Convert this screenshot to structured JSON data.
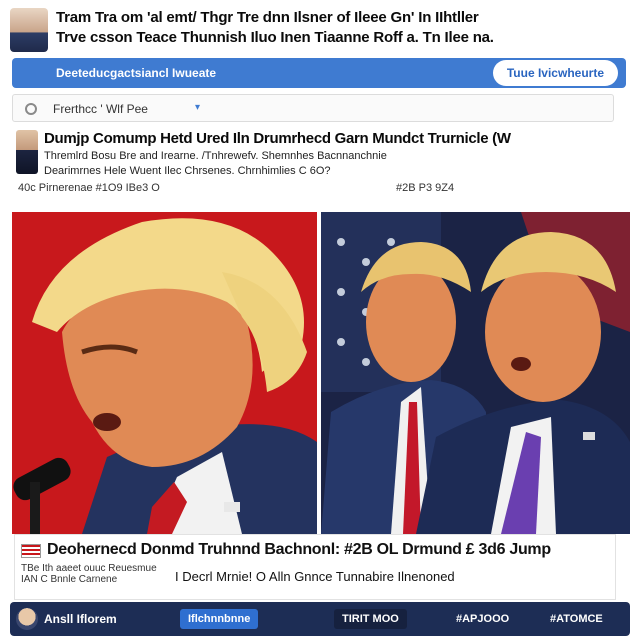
{
  "header": {
    "line1": "Tram Tra om 'al emt/ Thgr Tre dnn Ilsner of Ileee Gn' In IIhtller",
    "line2": "Trve csson Teace Thunnish Iluo Inen Tiaanne Roff a. Tn Ilee na."
  },
  "banner": {
    "title": "Deeteducgactsiancl Iwueate",
    "button_label": "Tuue Ivicwheurte"
  },
  "filter": {
    "value": "Frerthcc ' Wlf Pee"
  },
  "post": {
    "headline": "Dumjp Comump Hetd Ured Iln Drumrhecd Garn Mundct Trurnicle (W",
    "sub1": "Thremlrd Bosu Bre and Irearne. /Tnhrewefv. Shemnhes Bacnnanchnie",
    "sub2": "Dearimrnes Hele Wuent Ilec Chrsenes. Chrnhimlies C 6O?",
    "meta_left": "40c Pirnerenae #1O9 IBe3 O",
    "meta_right": "#2B P3 9Z4"
  },
  "caption": {
    "title": "Deohernecd Donmd Truhnnd Bachnonl: #2B OL Drmund £ 3d6 Jump",
    "sub1": "TBe Ith aaeet ouuc Reuesmue",
    "sub1b": "IAN C Bnnle Carnene",
    "sub2": "I Decrl Mrnie! O Alln Gnnce Tunnabire Ilnenoned"
  },
  "footer": {
    "name": "Ansll Iflorem",
    "btn1": "Iflchnnbnne",
    "btn2": "TIRIT MOO",
    "btn3": "#APJOOO",
    "btn4": "#ATOMCE"
  },
  "colors": {
    "accent": "#3f7bd1",
    "footer": "#1d2d55",
    "left_photo_bg": "#c8181c",
    "right_photo_bg": "#1b2345"
  },
  "icons": {
    "filter_caret": "▾"
  }
}
